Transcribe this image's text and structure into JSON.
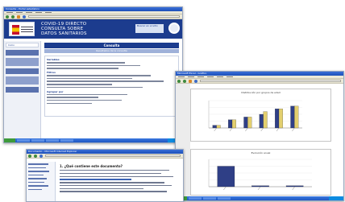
{
  "portal": {
    "title": "Consulta - Portal estadístico",
    "banner_text": "COVID-19 DIRECTO\nCONSULTA SOBRE\nDATOS SANITARIOS",
    "banner_box": "Buscar en el sitio",
    "side_header": "Inicio",
    "main_title": "Consulta",
    "main_subtitle": "Resultados de la consulta",
    "section_a": "Variables",
    "section_b": "Filtros",
    "section_c": "Agrupar por"
  },
  "chart_viewer": {
    "title": "Microsoft Excel - Gráfico",
    "chart1": {
      "title": "Distribución por grupos de edad"
    },
    "chart2": {
      "title": "Evolución anual"
    }
  },
  "document": {
    "title": "Documento - Microsoft Internet Explorer",
    "heading": "1. ¿Qué contiene este documento?"
  },
  "chart_data": [
    {
      "type": "bar",
      "categories": [
        "A",
        "B",
        "C",
        "D",
        "E",
        "F"
      ],
      "series": [
        {
          "values": [
            1,
            3,
            4,
            5,
            7,
            8
          ]
        },
        {
          "values": [
            1,
            3,
            4,
            6,
            7,
            8
          ]
        }
      ],
      "ylim": [
        0,
        10
      ],
      "colors": [
        "#2f3f86",
        "#e3cf6e"
      ]
    },
    {
      "type": "bar",
      "categories": [
        "A",
        "B",
        "C"
      ],
      "series": [
        {
          "values": [
            6,
            0.3,
            0.3
          ]
        }
      ],
      "ylim": [
        0,
        8
      ],
      "colors": [
        "#2f3f86"
      ]
    }
  ]
}
